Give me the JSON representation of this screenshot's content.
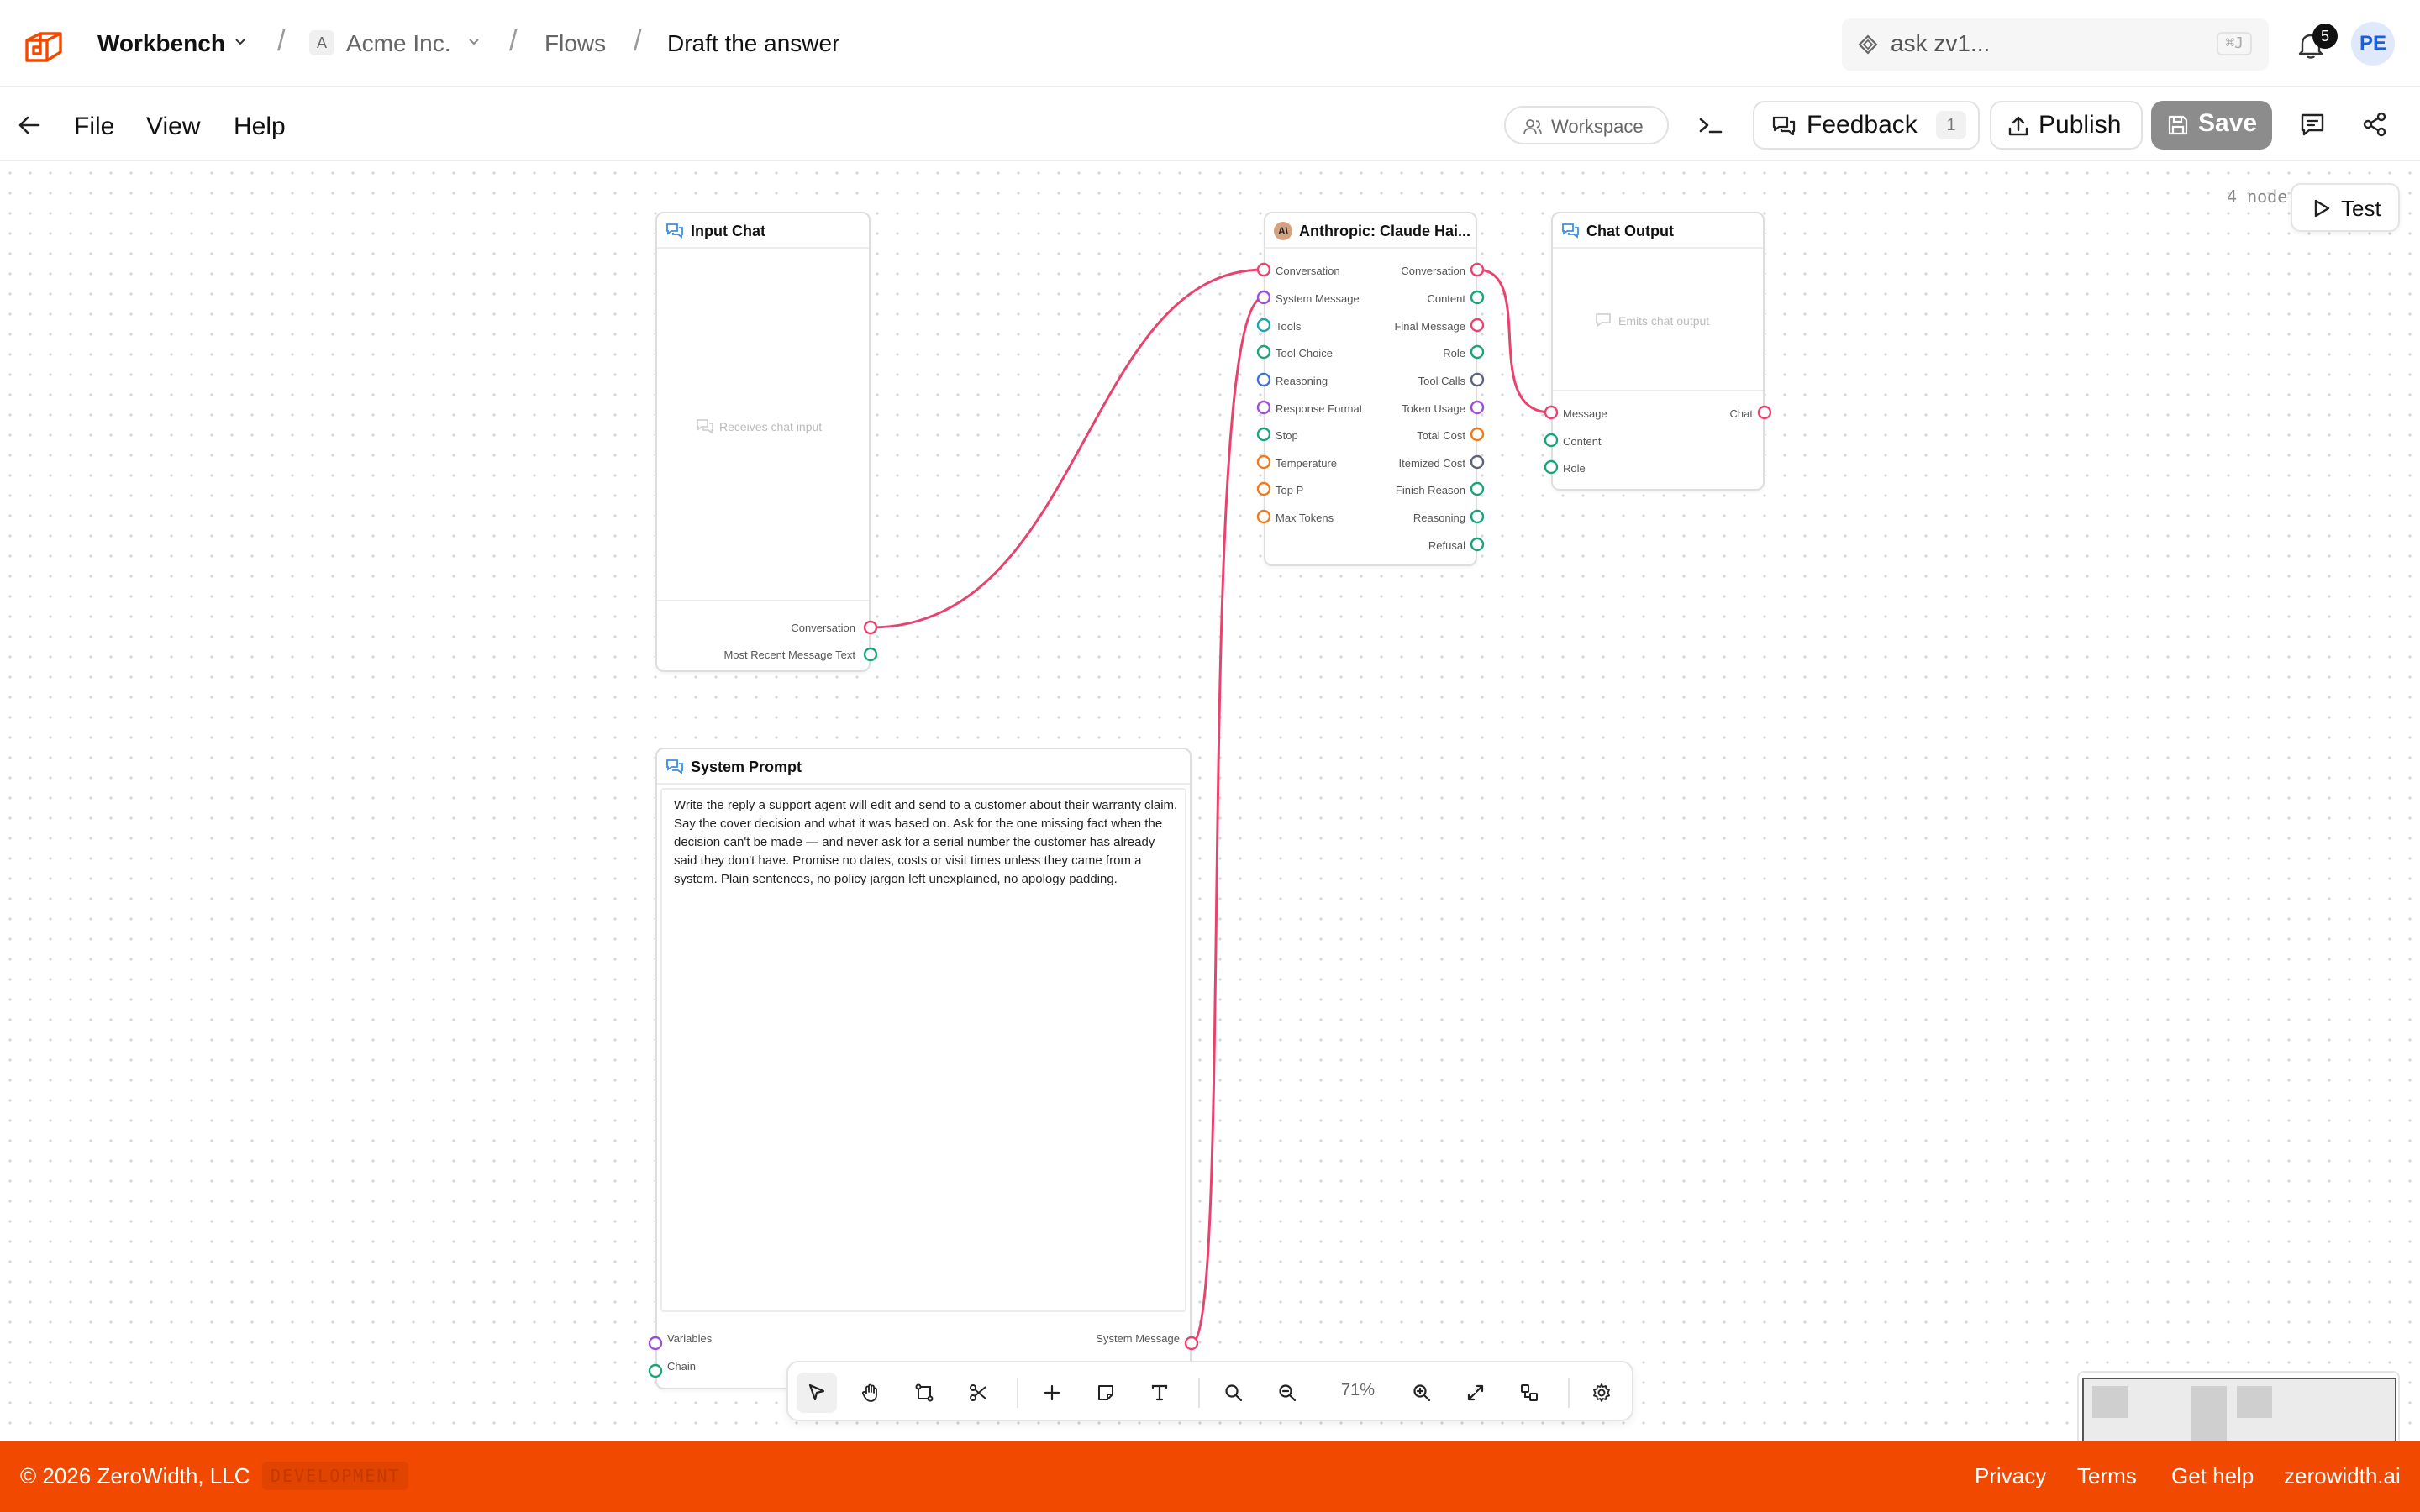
{
  "header": {
    "workspace": "Workbench",
    "org_initial": "A",
    "org": "Acme Inc.",
    "section": "Flows",
    "page": "Draft the answer",
    "search_placeholder": "ask zv1...",
    "search_shortcut": "⌘J",
    "notifications": "5",
    "user_initials": "PE"
  },
  "menubar": {
    "file": "File",
    "view": "View",
    "help": "Help",
    "workspace": "Workspace",
    "feedback": "Feedback",
    "feedback_count": "1",
    "publish": "Publish",
    "save": "Save"
  },
  "canvas": {
    "node_count": "4 node",
    "test": "Test",
    "zoom": "71%",
    "nodes": {
      "input_chat": {
        "title": "Input Chat",
        "hint": "Receives chat input",
        "outputs": [
          "Conversation",
          "Most Recent Message Text"
        ]
      },
      "llm": {
        "title": "Anthropic: Claude Hai...",
        "inputs": [
          "Conversation",
          "System Message",
          "Tools",
          "Tool Choice",
          "Reasoning",
          "Response Format",
          "Stop",
          "Temperature",
          "Top P",
          "Max Tokens"
        ],
        "outputs": [
          "Conversation",
          "Content",
          "Final Message",
          "Role",
          "Tool Calls",
          "Token Usage",
          "Total Cost",
          "Itemized Cost",
          "Finish Reason",
          "Reasoning",
          "Refusal"
        ]
      },
      "chat_output": {
        "title": "Chat Output",
        "hint": "Emits chat output",
        "inputs": [
          "Message",
          "Content",
          "Role"
        ],
        "outputs": [
          "Chat"
        ]
      },
      "system_prompt": {
        "title": "System Prompt",
        "text": "Write the reply a support agent will edit and send to a customer about their warranty claim. Say the cover decision and what it was based on. Ask for the one missing fact when the decision can't be made — and never ask for a serial number the customer has already said they don't have. Promise no dates, costs or visit times unless they came from a system. Plain sentences, no policy jargon left unexplained, no apology padding.",
        "inputs": [
          "Variables",
          "Chain"
        ],
        "outputs": [
          "System Message"
        ]
      }
    }
  },
  "footer": {
    "copyright": "© 2026 ZeroWidth, LLC",
    "env": "DEVELOPMENT",
    "privacy": "Privacy",
    "terms": "Terms",
    "help": "Get help",
    "site": "zerowidth.ai"
  },
  "colors": {
    "accent": "#f14a00",
    "edge": "#e8436f",
    "port_red": "#e8436f",
    "port_green": "#1aa37a",
    "port_teal": "#17a2b8",
    "port_blue": "#3d6fd6",
    "port_purple": "#9b4fd6",
    "port_orange": "#ee7a1c",
    "port_slate": "#5b6279"
  }
}
